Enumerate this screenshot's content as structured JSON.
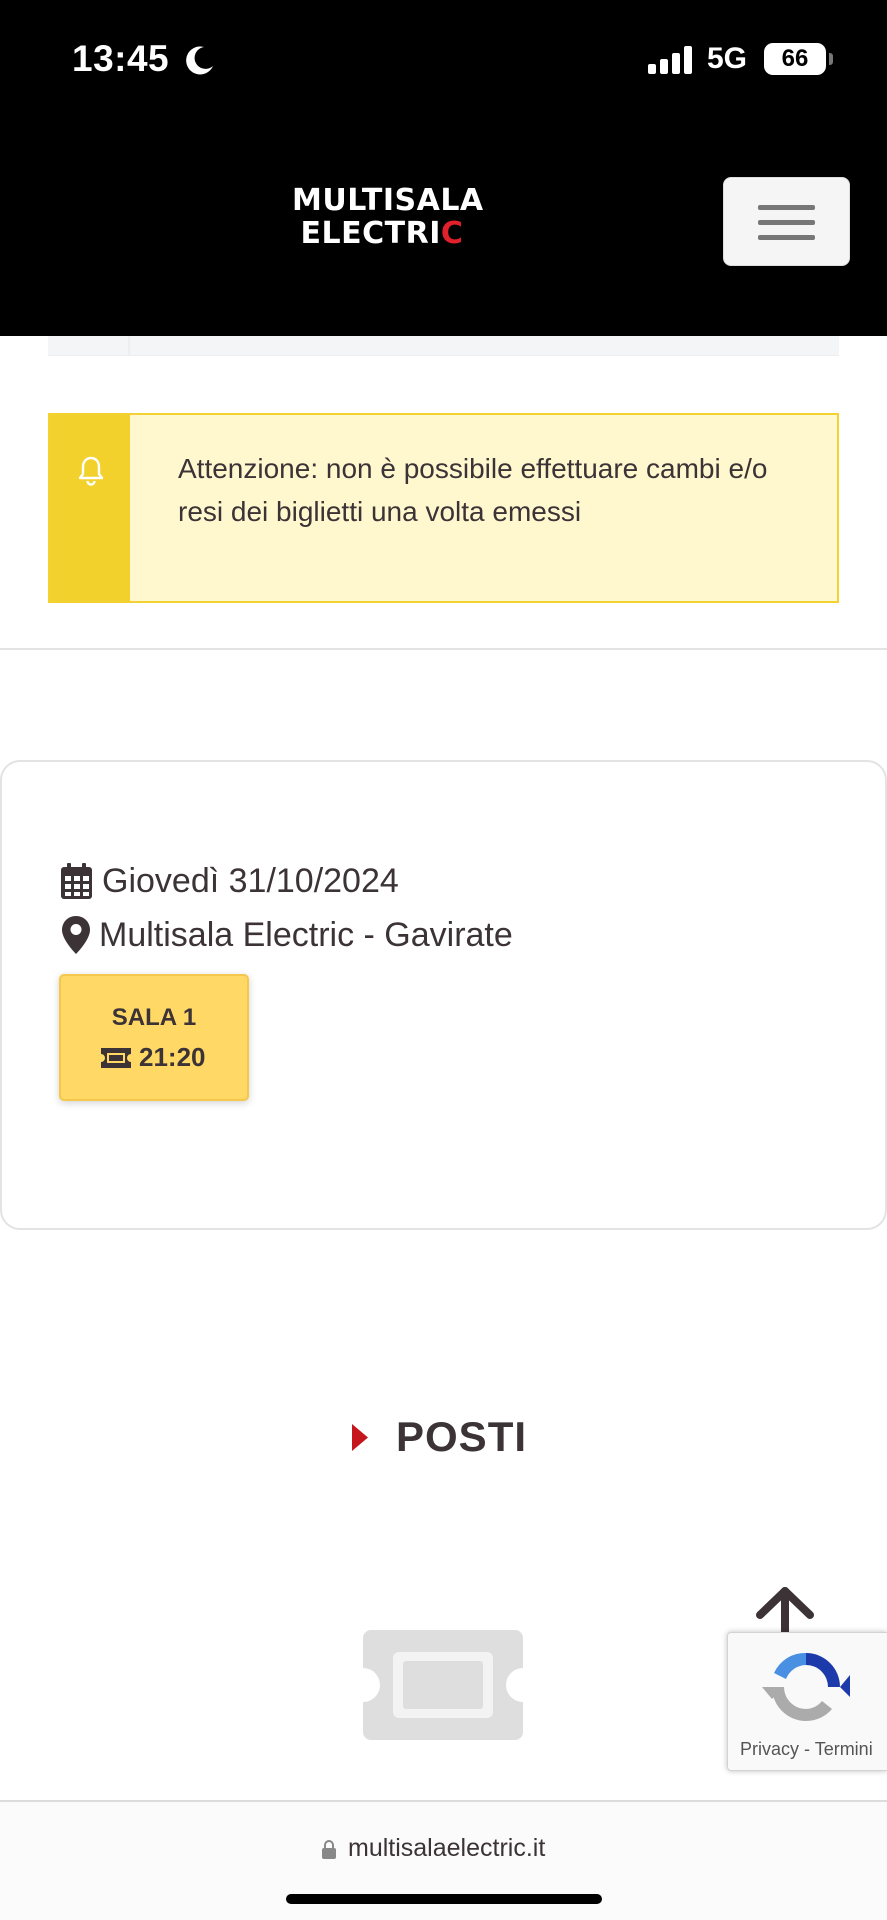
{
  "status_bar": {
    "time": "13:45",
    "network": "5G",
    "battery": "66"
  },
  "header": {
    "logo_line1": "MULTISALA",
    "logo_line2_main": "ELECTRI",
    "logo_line2_accent": "C",
    "logo_accent_color": "#e0202a",
    "menu_icon": "hamburger-menu-icon"
  },
  "alert": {
    "icon": "bell-icon",
    "text": "Attenzione: non è possibile effettuare cambi e/o resi dei biglietti una volta emessi",
    "bar_color": "#f2d12c",
    "background_color": "#fff8cf"
  },
  "showtime": {
    "date_icon": "calendar-icon",
    "date": "Giovedì 31/10/2024",
    "location_icon": "map-pin-icon",
    "location": "Multisala Electric - Gavirate",
    "screen": {
      "name": "SALA 1",
      "ticket_icon": "ticket-icon",
      "time": "21:20",
      "color": "#ffd866"
    }
  },
  "section": {
    "caret_icon": "caret-right-icon",
    "title": "POSTI",
    "caret_color": "#c4161c"
  },
  "placeholder_icon": "ticket-placeholder-icon",
  "scroll_top_icon": "arrow-up-icon",
  "recaptcha": {
    "logo_icon": "recaptcha-icon",
    "privacy": "Privacy",
    "separator": " - ",
    "terms": "Termini"
  },
  "browser": {
    "lock_icon": "lock-icon",
    "url": "multisalaelectric.it"
  }
}
